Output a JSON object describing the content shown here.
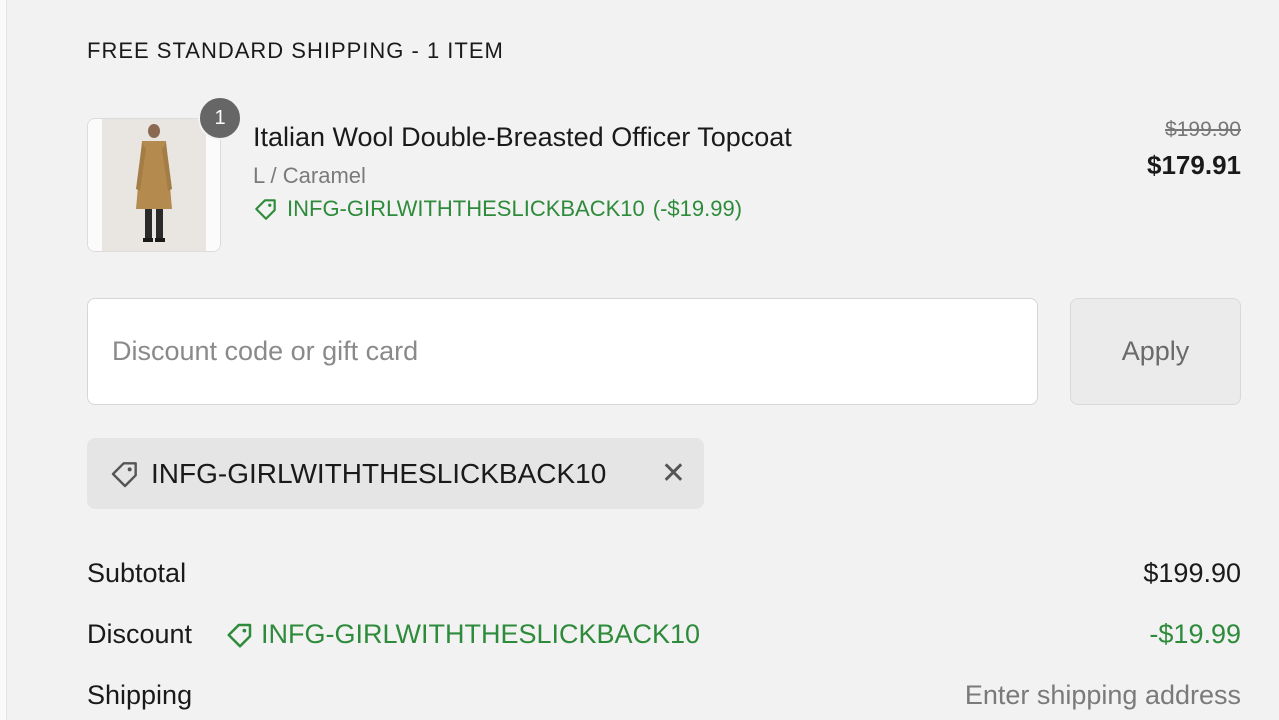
{
  "section": {
    "title": "FREE STANDARD SHIPPING - 1 ITEM"
  },
  "product": {
    "quantity": "1",
    "name": "Italian Wool Double-Breasted Officer Topcoat",
    "variant": "L / Caramel",
    "discount_code": "INFG-GIRLWITHTHESLICKBACK10",
    "discount_amount": "(-$19.99)",
    "price_original": "$199.90",
    "price_final": "$179.91",
    "image_icon": "coat-thumbnail"
  },
  "discount_form": {
    "placeholder": "Discount code or gift card",
    "value": "",
    "apply_label": "Apply"
  },
  "applied_code": {
    "label": "INFG-GIRLWITHTHESLICKBACK10",
    "remove_symbol": "✕"
  },
  "summary": {
    "subtotal_label": "Subtotal",
    "subtotal_value": "$199.90",
    "discount_label": "Discount",
    "discount_code": "INFG-GIRLWITHTHESLICKBACK10",
    "discount_value": "-$19.99",
    "shipping_label": "Shipping",
    "shipping_value": "Enter shipping address"
  },
  "colors": {
    "accent_green": "#2e8b3b",
    "badge": "#666666"
  }
}
